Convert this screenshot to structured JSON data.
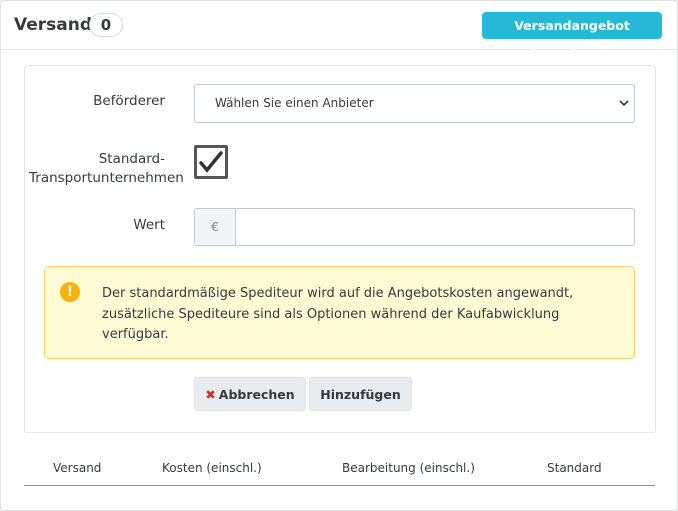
{
  "header": {
    "title": "Versand",
    "count": "0",
    "add_offer_button": "Versandangebot hinzufügen"
  },
  "form": {
    "carrier_label": "Beförderer",
    "carrier_select_value": "Wählen Sie einen Anbieter",
    "default_carrier_label_line1": "Standard-",
    "default_carrier_label_line2": "Transportunternehmen",
    "default_carrier_checked": true,
    "value_label": "Wert",
    "currency_symbol": "€",
    "value_input": ""
  },
  "alert": {
    "icon": "warning-icon",
    "text": "Der standardmäßige Spediteur wird auf die Angebotskosten angewandt, zusätzliche Spediteure sind als Optionen während der Kaufabwicklung verfügbar."
  },
  "actions": {
    "cancel_label": "Abbrechen",
    "add_label": "Hinzufügen"
  },
  "table": {
    "columns": [
      "Versand",
      "Kosten (einschl.)",
      "Bearbeitung (einschl.)",
      "Standard"
    ]
  },
  "colors": {
    "accent": "#25b9d7",
    "warning_bg": "#fffbd5",
    "warning_border": "#f3ce69",
    "cancel_icon": "#c4312f"
  }
}
